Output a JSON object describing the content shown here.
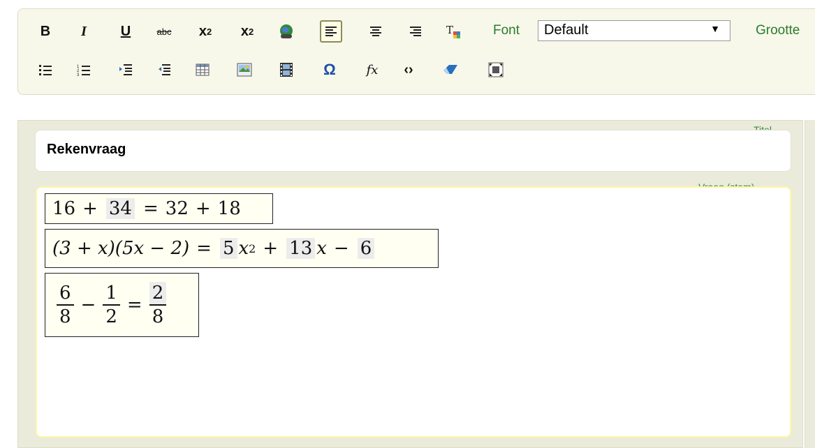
{
  "toolbar": {
    "bold": "B",
    "italic": "I",
    "underline": "U",
    "strike": "abc",
    "sub_base": "x",
    "sub_idx": "2",
    "sup_base": "x",
    "sup_idx": "2",
    "font_label": "Font",
    "font_value": "Default",
    "size_label": "Grootte",
    "omega": "Ω",
    "fx": "fx",
    "code": "‹›"
  },
  "editor": {
    "title_label": "Titel",
    "title_value": "Rekenvraag",
    "question_label": "Vraag (stam)"
  },
  "equations": {
    "eq1": {
      "a": "16",
      "plus": "+",
      "gap": "34",
      "eq": "=",
      "b": "32",
      "plus2": "+",
      "c": "18"
    },
    "eq2": {
      "lhs": "(3 + x)(5x − 2)",
      "eq": "=",
      "g1": "5",
      "x2": "x",
      "p2": "2",
      "plus": "+",
      "g2": "13",
      "x1": "x",
      "minus": "−",
      "g3": "6"
    },
    "eq3": {
      "f1n": "6",
      "f1d": "8",
      "minus": "−",
      "f2n": "1",
      "f2d": "2",
      "eq": "=",
      "f3n": "2",
      "f3d": "8"
    }
  }
}
